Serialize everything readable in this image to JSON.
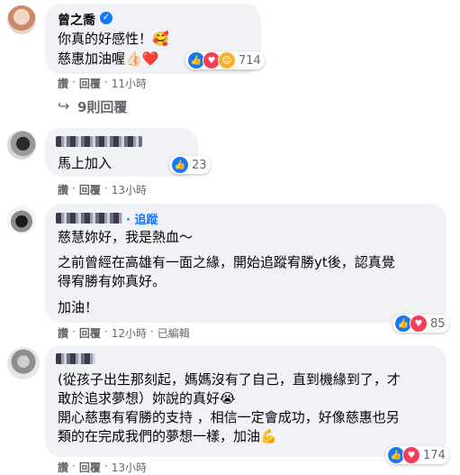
{
  "comments": [
    {
      "author": "曾之喬",
      "lines": [
        "你真的好感性！🥰",
        "慈惠加油喔👍🏻❤️"
      ],
      "reaction_count": "714",
      "actions": [
        "讚",
        "回覆",
        "11小時"
      ],
      "view_replies": "9則回覆"
    },
    {
      "author": "",
      "lines": [
        "馬上加入"
      ],
      "reaction_count": "23",
      "actions": [
        "讚",
        "回覆",
        "13小時"
      ]
    },
    {
      "author": "",
      "follow": "追蹤",
      "lines": [
        "慈慧妳好，我是熱血～",
        "",
        "之前曾經在高雄有一面之緣，開始追蹤宥勝yt後，認真覺",
        "得宥勝有妳真好。",
        "",
        "加油！"
      ],
      "reaction_count": "85",
      "actions": [
        "讚",
        "回覆",
        "12小時",
        "已編輯"
      ]
    },
    {
      "author": "",
      "lines": [
        "(從孩子出生那刻起，媽媽沒有了自己，直到機緣到了，才",
        "敢於追求夢想）妳說的真好😭",
        "開心慈惠有宥勝的支持 ，相信一定會成功，好像慈惠也另",
        "類的在完成我們的夢想一樣，加油💪"
      ],
      "reaction_count": "174",
      "actions": [
        "讚",
        "回覆",
        "13小時"
      ]
    }
  ],
  "colors": {
    "bubble": "#f0f2f5",
    "like": "#1877f2",
    "love": "#f33e58",
    "meta": "#65676b"
  }
}
